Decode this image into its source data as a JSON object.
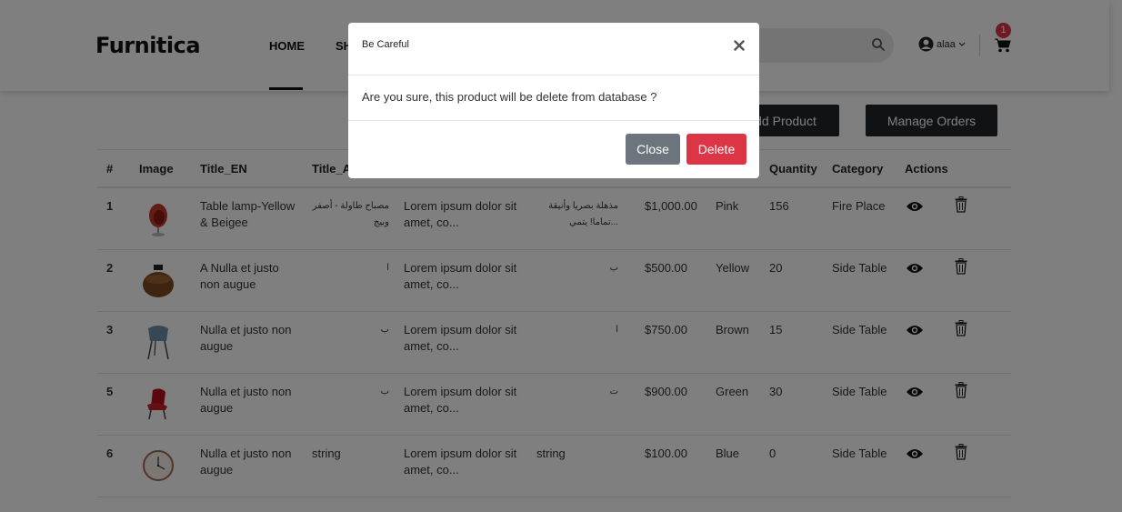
{
  "header": {
    "logo": "Furnitica",
    "nav": {
      "home": "HOME",
      "shop": "SH"
    },
    "user": {
      "name": "alaa"
    },
    "cart": {
      "count": "1"
    }
  },
  "actions": {
    "add_product": "dd Product",
    "manage_orders": "Manage Orders"
  },
  "table": {
    "headers": {
      "num": "#",
      "image": "Image",
      "title_en": "Title_EN",
      "title_ar": "Title_A",
      "quantity": "Quantity",
      "category": "Category",
      "actions": "Actions"
    },
    "rows": [
      {
        "num": "1",
        "title_en": "Table lamp-Yellow & Beigee",
        "title_ar": "مصباح طاولة - أصفر وبيج",
        "desc_en": "Lorem ipsum dolor sit amet, co...",
        "desc_ar": "مذهلة بصريا وأنيقة ...تماما! يتمي",
        "price": "$1,000.00",
        "color": "Pink",
        "quantity": "156",
        "category": "Fire Place",
        "image_icon": "chair-red-egg-icon"
      },
      {
        "num": "2",
        "title_en": "A Nulla et justo non augue",
        "title_ar": "ا",
        "desc_en": "Lorem ipsum dolor sit amet, co...",
        "desc_ar": "ب",
        "price": "$500.00",
        "color": "Yellow",
        "quantity": "20",
        "category": "Side Table",
        "image_icon": "pouf-brown-icon"
      },
      {
        "num": "3",
        "title_en": "Nulla et justo non augue",
        "title_ar": "ب",
        "desc_en": "Lorem ipsum dolor sit amet, co...",
        "desc_ar": "ا",
        "price": "$750.00",
        "color": "Brown",
        "quantity": "15",
        "category": "Side Table",
        "image_icon": "chair-blue-icon"
      },
      {
        "num": "5",
        "title_en": "Nulla et justo non augue",
        "title_ar": "ب",
        "desc_en": "Lorem ipsum dolor sit amet, co...",
        "desc_ar": "ت",
        "price": "$900.00",
        "color": "Green",
        "quantity": "30",
        "category": "Side Table",
        "image_icon": "chair-red-icon"
      },
      {
        "num": "6",
        "title_en": "Nulla et justo non augue",
        "title_ar": "string",
        "desc_en": "Lorem ipsum dolor sit amet, co...",
        "desc_ar": "string",
        "price": "$100.00",
        "color": "Blue",
        "quantity": "0",
        "category": "Side Table",
        "image_icon": "wall-clock-icon"
      }
    ]
  },
  "modal": {
    "title": "Be Careful",
    "body": "Are you sure, this product will be delete from database ?",
    "close_label": "Close",
    "delete_label": "Delete"
  },
  "colors": {
    "danger": "#dc3545",
    "secondary": "#6c757d",
    "dark": "#212529",
    "overlay": "rgba(0,0,0,0.5)"
  }
}
